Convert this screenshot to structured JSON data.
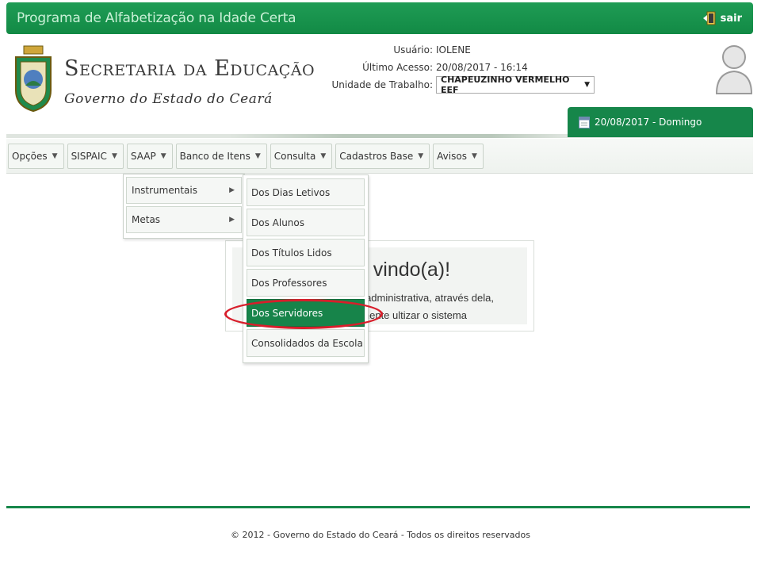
{
  "topbar": {
    "app_title": "Programa de Alfabetização na Idade Certa",
    "logout_label": "sair"
  },
  "header": {
    "org_title": "Secretaria da Educação",
    "org_subtitle": "Governo do Estado do Ceará"
  },
  "user_info": {
    "user_label": "Usuário:",
    "user_value": "IOLENE",
    "last_access_label": "Último Acesso:",
    "last_access_value": "20/08/2017 - 16:14",
    "work_unit_label": "Unidade de Trabalho:",
    "work_unit_value": "CHAPEUZINHO VERMELHO EEF"
  },
  "date_tab": {
    "label": "20/08/2017 - Domingo"
  },
  "menu": {
    "items": [
      {
        "label": "Opções"
      },
      {
        "label": "SISPAIC"
      },
      {
        "label": "SAAP"
      },
      {
        "label": "Banco de Itens"
      },
      {
        "label": "Consulta"
      },
      {
        "label": "Cadastros Base"
      },
      {
        "label": "Avisos"
      }
    ]
  },
  "saap_submenu": {
    "items": [
      {
        "label": "Instrumentais"
      },
      {
        "label": "Metas"
      }
    ]
  },
  "instrumentais_submenu": {
    "items": [
      {
        "label": "Dos Dias Letivos"
      },
      {
        "label": "Dos Alunos"
      },
      {
        "label": "Dos Títulos Lidos"
      },
      {
        "label": "Dos Professores"
      },
      {
        "label": "Dos Servidores"
      },
      {
        "label": "Consolidados da Escola"
      }
    ],
    "active_label": "Dos Servidores"
  },
  "welcome": {
    "title_visible": "m vindo(a)!",
    "line1_visible": "ea administrativa, através dela,",
    "line2_visible": "cilmente ultizar o sistema"
  },
  "footer": {
    "text": "© 2012 - Governo do Estado do Ceará - Todos os direitos reservados"
  },
  "colors": {
    "primary_green": "#16864a",
    "highlight_red": "#d81e2b"
  },
  "icons": [
    "logout-icon",
    "crest-logo",
    "avatar-icon",
    "calendar-icon",
    "chevron-down-icon",
    "chevron-right-icon"
  ]
}
